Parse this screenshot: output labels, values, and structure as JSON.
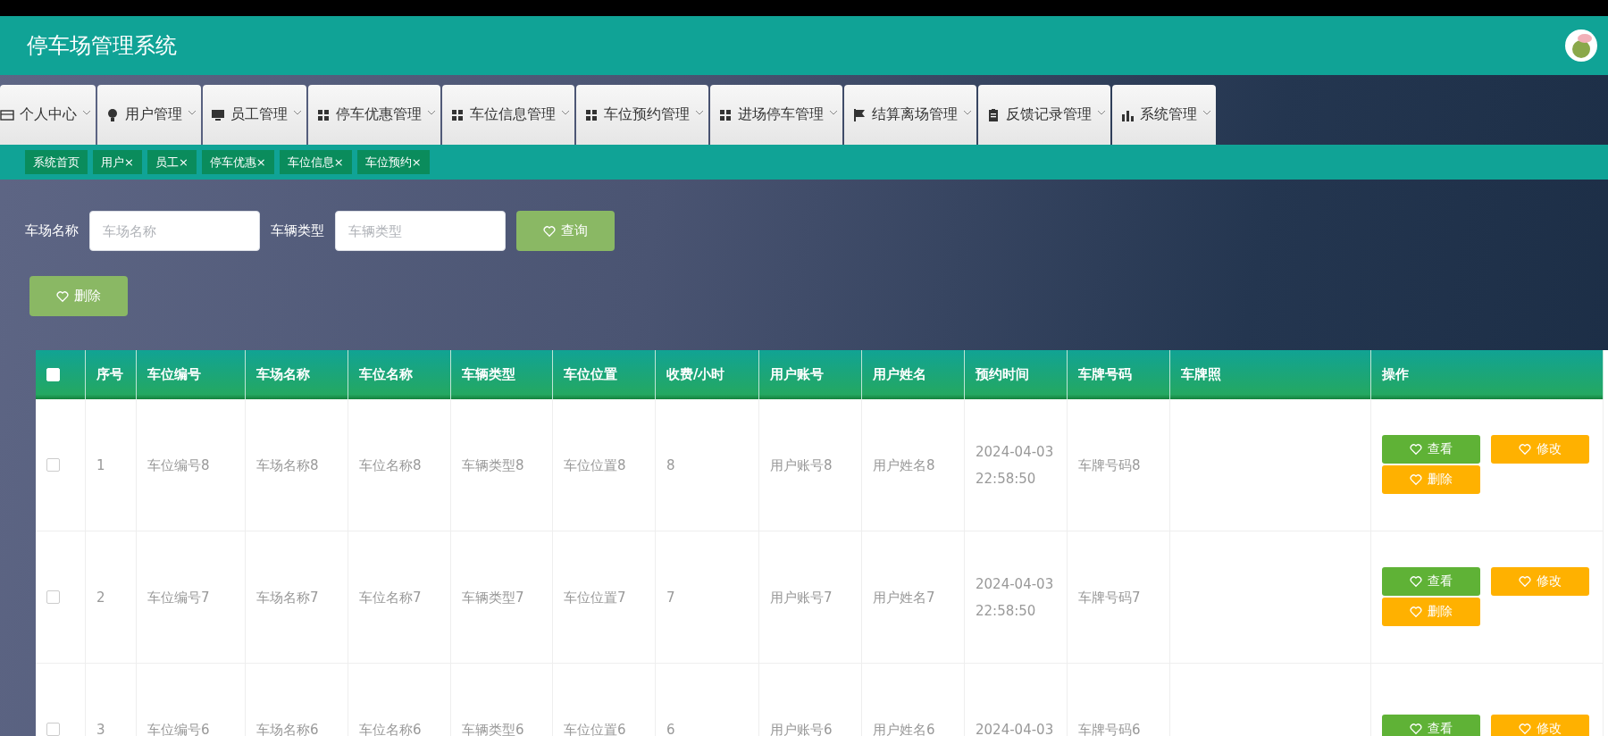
{
  "header": {
    "title": "停车场管理系统"
  },
  "nav": [
    {
      "label": "个人中心",
      "kind": "card"
    },
    {
      "label": "用户管理",
      "kind": "bulb"
    },
    {
      "label": "员工管理",
      "kind": "monitor"
    },
    {
      "label": "停车优惠管理",
      "kind": "grid"
    },
    {
      "label": "车位信息管理",
      "kind": "grid"
    },
    {
      "label": "车位预约管理",
      "kind": "grid"
    },
    {
      "label": "进场停车管理",
      "kind": "grid"
    },
    {
      "label": "结算离场管理",
      "kind": "flag"
    },
    {
      "label": "反馈记录管理",
      "kind": "clipboard"
    },
    {
      "label": "系统管理",
      "kind": "chart"
    }
  ],
  "tags": [
    {
      "label": "系统首页"
    },
    {
      "label": "用户",
      "close": "×"
    },
    {
      "label": "员工",
      "close": "×"
    },
    {
      "label": "停车优惠",
      "close": "×"
    },
    {
      "label": "车位信息",
      "close": "×"
    },
    {
      "label": "车位预约",
      "close": "×"
    }
  ],
  "search": {
    "fields": [
      {
        "label": "车场名称",
        "placeholder": "车场名称"
      },
      {
        "label": "车辆类型",
        "placeholder": "车辆类型"
      }
    ],
    "button": "查询"
  },
  "toolbar": {
    "delete_button": "删除"
  },
  "table": {
    "select_all": {
      "checked": false
    },
    "columns": [
      "序号",
      "车位编号",
      "车场名称",
      "车位名称",
      "车辆类型",
      "车位位置",
      "收费/小时",
      "用户账号",
      "用户姓名",
      "预约时间",
      "车牌号码",
      "车牌照",
      "操作"
    ],
    "rows": [
      {
        "checked": false,
        "cells": [
          "1",
          "车位编号8",
          "车场名称8",
          "车位名称8",
          "车辆类型8",
          "车位位置8",
          "8",
          "用户账号8",
          "用户姓名8",
          "2024-04-03 22:58:50",
          "车牌号码8"
        ],
        "actions": [
          {
            "label": "查看",
            "kind": "view"
          },
          {
            "label": "修改",
            "kind": "edit"
          },
          {
            "label": "删除",
            "kind": "delete"
          }
        ]
      },
      {
        "checked": false,
        "cells": [
          "2",
          "车位编号7",
          "车场名称7",
          "车位名称7",
          "车辆类型7",
          "车位位置7",
          "7",
          "用户账号7",
          "用户姓名7",
          "2024-04-03 22:58:50",
          "车牌号码7"
        ],
        "actions": [
          {
            "label": "查看",
            "kind": "view"
          },
          {
            "label": "修改",
            "kind": "edit"
          },
          {
            "label": "删除",
            "kind": "delete"
          }
        ]
      },
      {
        "checked": false,
        "cells": [
          "3",
          "车位编号6",
          "车场名称6",
          "车位名称6",
          "车辆类型6",
          "车位位置6",
          "6",
          "用户账号6",
          "用户姓名6",
          "2024-04-03",
          "车牌号码6"
        ],
        "actions": [
          {
            "label": "查看",
            "kind": "view"
          },
          {
            "label": "修改",
            "kind": "edit"
          }
        ]
      }
    ]
  }
}
